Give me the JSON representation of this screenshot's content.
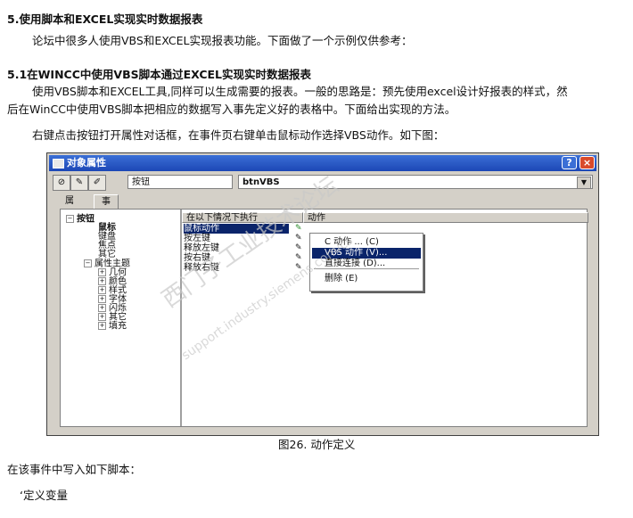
{
  "doc": {
    "heading5": "5.使用脚本和EXCEL实现实时数据报表",
    "para1": "论坛中很多人使用VBS和EXCEL实现报表功能。下面做了一个示例仅供参考：",
    "heading51": "5.1在WINCC中使用VBS脚本通过EXCEL实现实时数据报表",
    "para2a": "使用VBS脚本和EXCEL工具,同样可以生成需要的报表。一般的思路是：预先使用excel设计好报表的样式，然",
    "para2b": "后在WinCC中使用VBS脚本把相应的数据写入事先定义好的表格中。下面给出实现的方法。",
    "para3": "右键点击按钮打开属性对话框，在事件页右键单击鼠标动作选择VBS动作。如下图：",
    "caption": "图26. 动作定义",
    "para4": "在该事件中写入如下脚本：",
    "code1": "‘定义变量"
  },
  "dialog": {
    "title": "对象属性",
    "help_btn": "?",
    "close_btn": "×",
    "object_type": "按钮",
    "object_name": "btnVBS",
    "tabs": [
      "属性",
      "事件"
    ],
    "tree": {
      "root": "按钮",
      "items": [
        "鼠标",
        "键盘",
        "焦点",
        "其它"
      ],
      "group": "属性主题",
      "sub": [
        "几何",
        "颜色",
        "样式",
        "字体",
        "闪烁",
        "其它",
        "填充"
      ]
    },
    "columns": [
      "在以下情况下执行",
      "动作"
    ],
    "events": [
      "鼠标动作",
      "按左键",
      "释放左键",
      "按右键",
      "释放右键"
    ],
    "menu": [
      "C 动作 ... (C)",
      "VBS 动作 (V)...",
      "直接连接 (D)...",
      "删除 (E)"
    ]
  },
  "watermark": {
    "text": "西门子工业技术论坛",
    "url": "support.industry.siemens.com/cs"
  }
}
